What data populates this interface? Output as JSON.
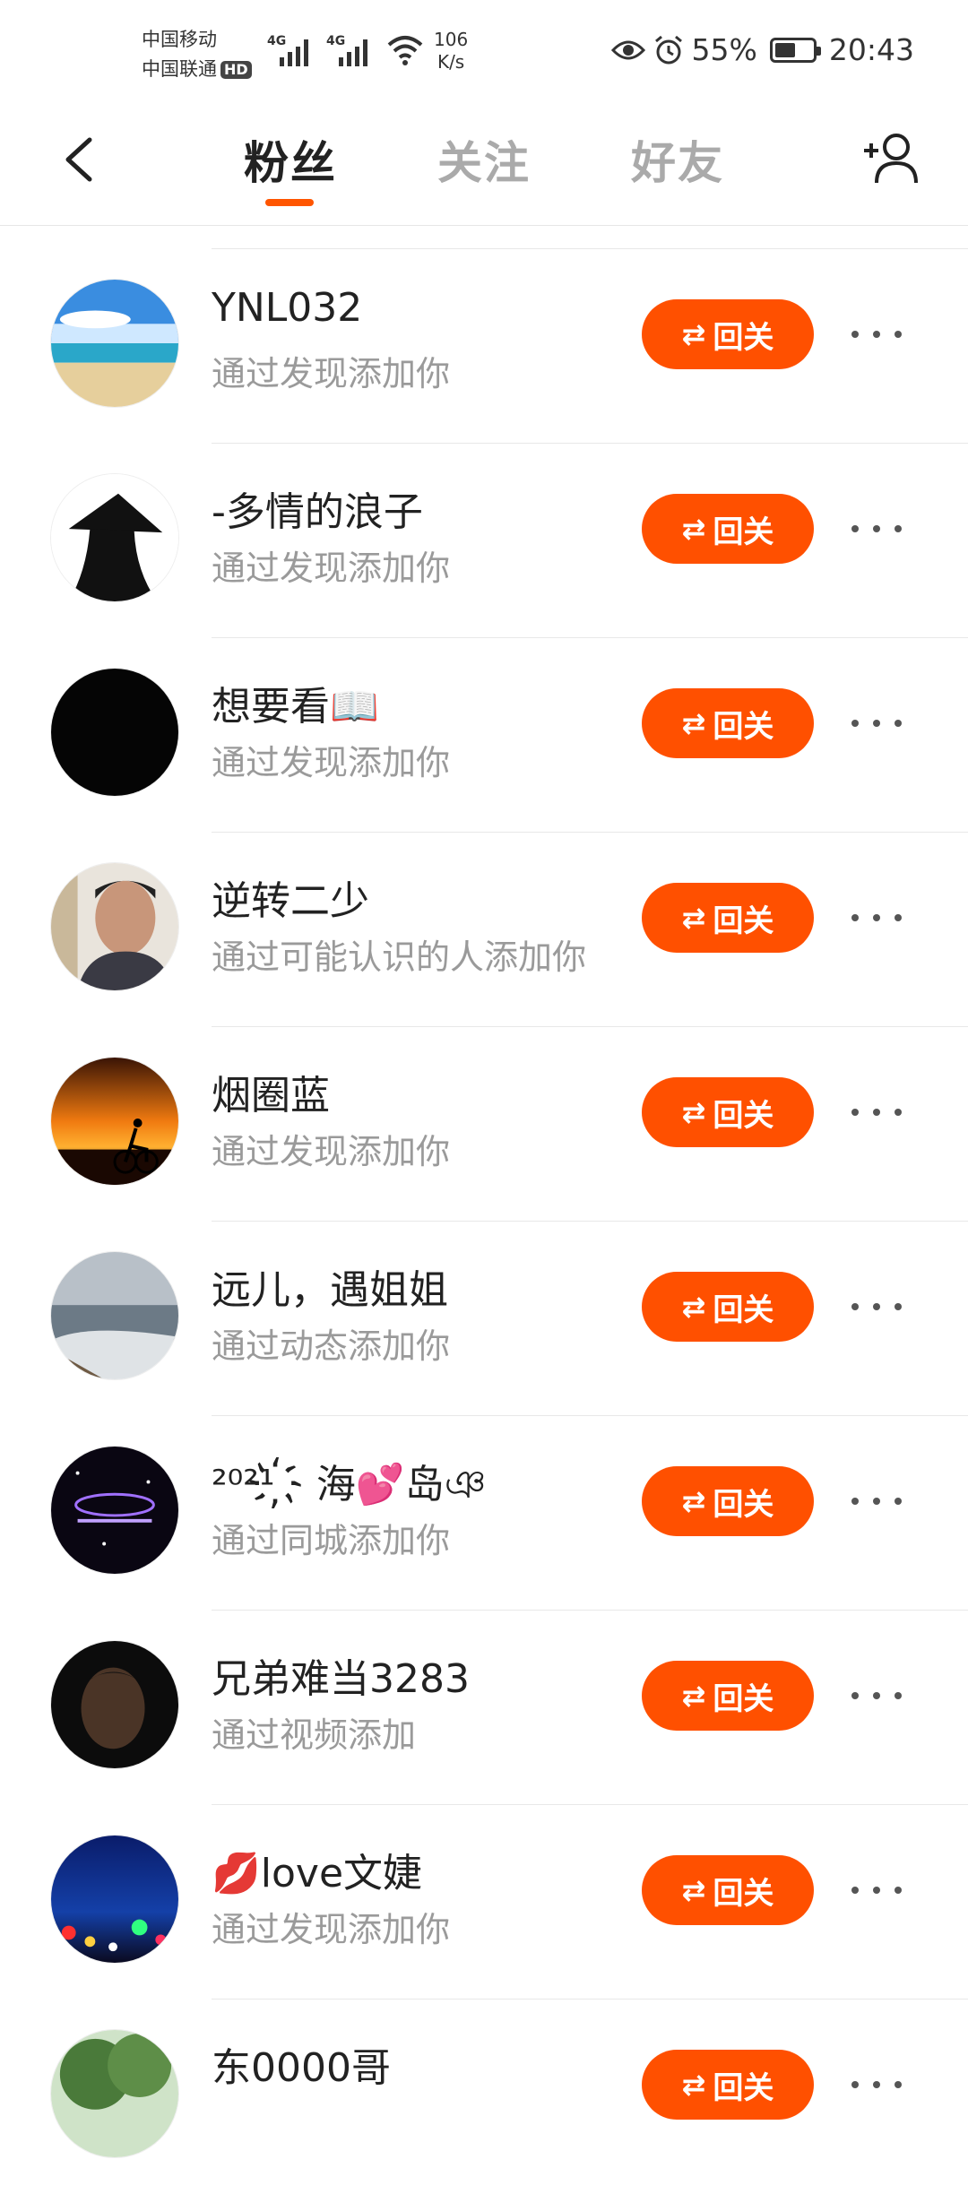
{
  "status_bar": {
    "carrier1": "中国移动",
    "carrier2": "中国联通",
    "hd": "HD",
    "network1": "4G",
    "network2": "4G",
    "speed_value": "106",
    "speed_unit": "K/s",
    "battery": "55%",
    "battery_level": 0.55,
    "time": "20:43"
  },
  "nav": {
    "tabs": [
      {
        "label": "粉丝",
        "active": true
      },
      {
        "label": "关注",
        "active": false
      },
      {
        "label": "好友",
        "active": false
      }
    ]
  },
  "follow_button_label": "回关",
  "followers": [
    {
      "name": "YNL032",
      "source": "通过发现添加你",
      "avatar": "beach"
    },
    {
      "name": "-多情的浪子",
      "source": "通过发现添加你",
      "avatar": "hat-silhouette"
    },
    {
      "name": "想要看📖",
      "source": "通过发现添加你",
      "avatar": "black"
    },
    {
      "name": "逆转二少",
      "source": "通过可能认识的人添加你",
      "avatar": "man-photo"
    },
    {
      "name": "烟圈蓝",
      "source": "通过发现添加你",
      "avatar": "sunset-cyclist"
    },
    {
      "name": "远儿，遇姐姐",
      "source": "通过动态添加你",
      "avatar": "seashore"
    },
    {
      "name": "²⁰²¹ ҉ 海💕岛ঞ",
      "source": "通过同城添加你",
      "avatar": "night-text"
    },
    {
      "name": "兄弟难当3283",
      "source": "通过视频添加",
      "avatar": "dark-face"
    },
    {
      "name": "💋love文婕",
      "source": "通过发现添加你",
      "avatar": "city-lights"
    },
    {
      "name": "东0000哥",
      "source": "",
      "avatar": "tree"
    }
  ]
}
